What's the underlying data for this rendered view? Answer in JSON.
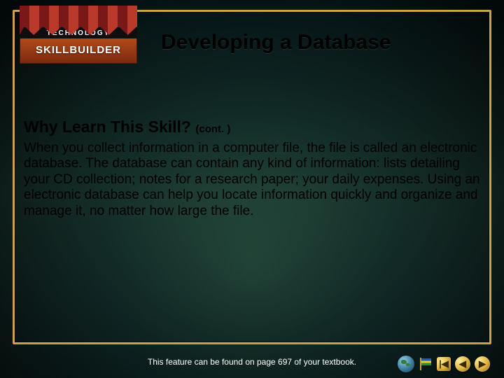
{
  "badge": {
    "top_label": "TECHNOLOGY",
    "main_label": "SKILLBUILDER"
  },
  "title": "Developing a Database",
  "subheading": {
    "text": "Why Learn This Skill?",
    "cont": "(cont. )"
  },
  "body": "When you collect information in a computer file, the file is called an electronic database. The database can contain any kind of information: lists detailing your CD collection; notes for a research paper; your daily expenses. Using an electronic database can help you locate information quickly and organize and manage it, no matter how large the file.",
  "footer": "This feature can be found on page 697 of your textbook.",
  "nav": {
    "prev_glyph": "◀",
    "start_glyph": "|◀",
    "next_glyph": "▶"
  }
}
